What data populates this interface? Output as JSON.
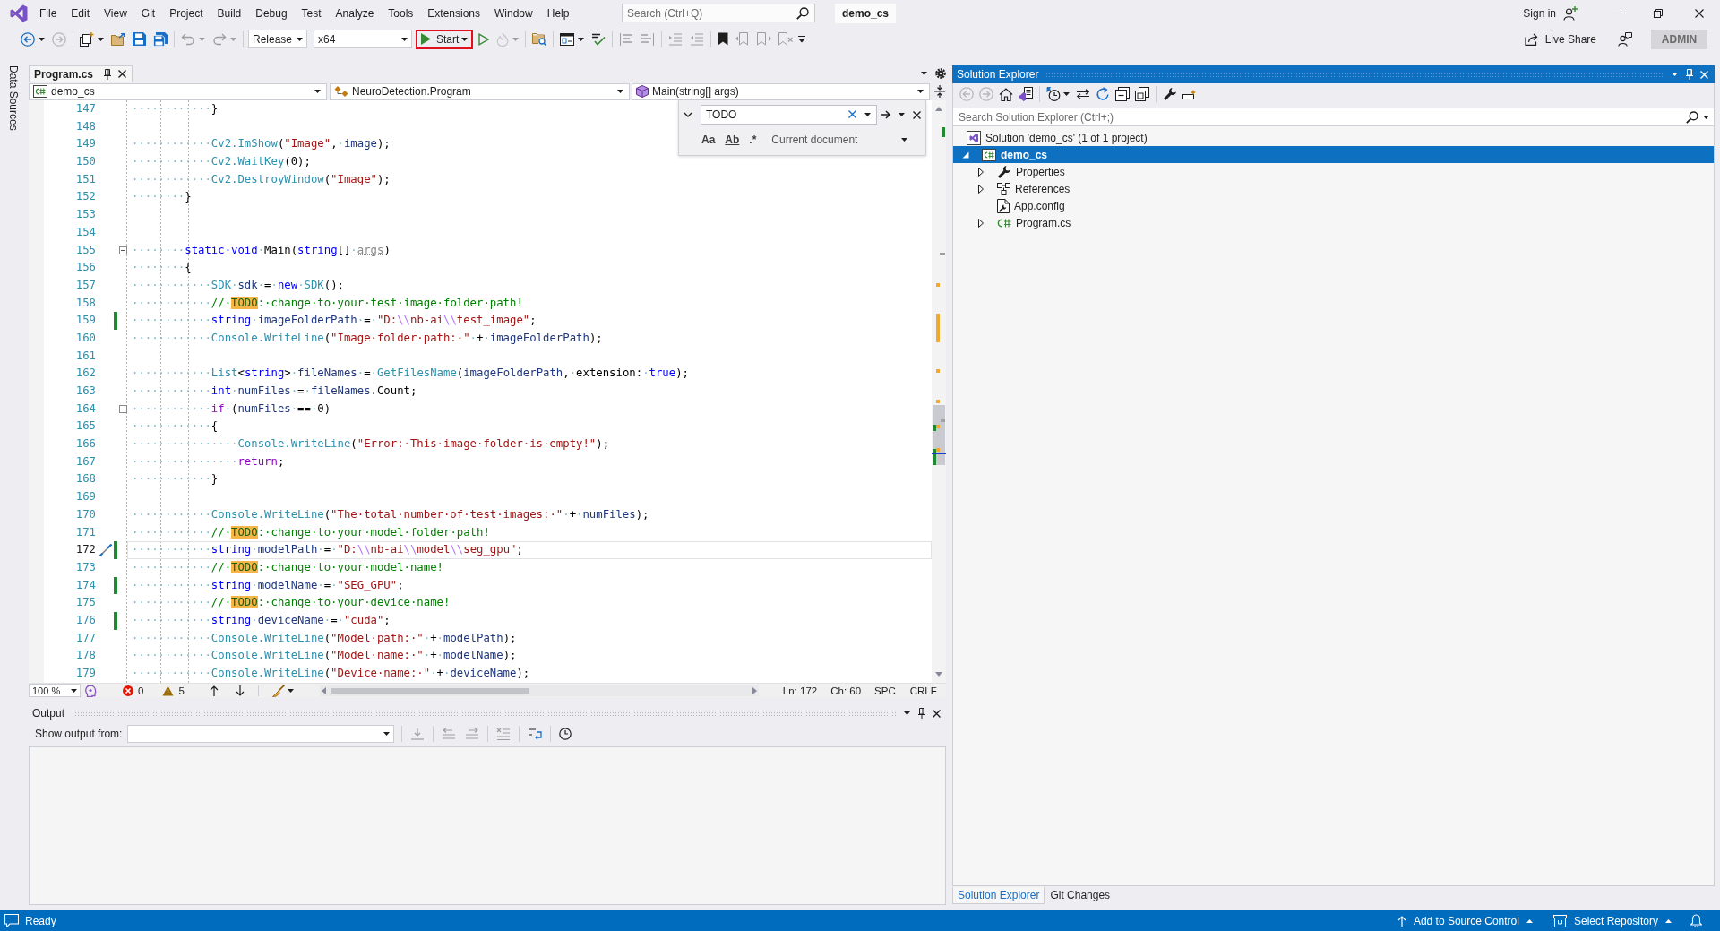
{
  "title_bar": {
    "menu": [
      "File",
      "Edit",
      "View",
      "Git",
      "Project",
      "Build",
      "Debug",
      "Test",
      "Analyze",
      "Tools",
      "Extensions",
      "Window",
      "Help"
    ],
    "search": {
      "placeholder": "Search (Ctrl+Q)"
    },
    "solution_name": "demo_cs",
    "sign_in": "Sign in"
  },
  "toolbar": {
    "left_groups": [
      [
        {
          "kind": "back",
          "disabled": false,
          "menu": true
        },
        {
          "kind": "forward",
          "disabled": true,
          "menu": false
        }
      ],
      [
        {
          "kind": "newitem",
          "disabled": false,
          "menu": true
        },
        {
          "kind": "open",
          "disabled": false,
          "menu": false
        },
        {
          "kind": "save",
          "disabled": false,
          "menu": false
        },
        {
          "kind": "saveall",
          "disabled": false,
          "menu": false
        }
      ],
      [
        {
          "kind": "undo",
          "disabled": true,
          "menu": true
        },
        {
          "kind": "redo",
          "disabled": true,
          "menu": true
        }
      ]
    ],
    "configuration": "Release",
    "platform": "x64",
    "start_button": {
      "label": "Start",
      "highlighted": true
    },
    "right_groups": [
      [
        {
          "kind": "run",
          "disabled": false,
          "menu": false
        },
        {
          "kind": "hotreload",
          "disabled": true,
          "menu": true
        }
      ],
      [
        {
          "kind": "findfiles",
          "disabled": false,
          "menu": false
        }
      ],
      [
        {
          "kind": "layout",
          "disabled": false,
          "menu": true
        },
        {
          "kind": "spellcheck",
          "disabled": false,
          "menu": false
        }
      ],
      [
        {
          "kind": "comment",
          "disabled": true,
          "menu": false
        },
        {
          "kind": "uncomment",
          "disabled": true,
          "menu": false
        }
      ],
      [
        {
          "kind": "indent",
          "disabled": true,
          "menu": false
        },
        {
          "kind": "outdent",
          "disabled": true,
          "menu": false
        }
      ],
      [
        {
          "kind": "bookmark",
          "disabled": false,
          "menu": false
        },
        {
          "kind": "prevbookmark",
          "disabled": true,
          "menu": false
        },
        {
          "kind": "nextbookmark",
          "disabled": true,
          "menu": false
        },
        {
          "kind": "clearbookmark",
          "disabled": true,
          "menu": false
        }
      ]
    ],
    "live_share": "Live Share",
    "account": "ADMIN"
  },
  "side_tab": "Data Sources",
  "editor": {
    "tabs": [
      {
        "label": "Program.cs",
        "selected": true
      }
    ],
    "navigation": {
      "project": "demo_cs",
      "type": "NeuroDetection.Program",
      "member": "Main(string[] args)"
    },
    "lines": [
      {
        "number": "147",
        "changed": false,
        "fold": false,
        "current": false,
        "tokens": [
          {
            "kind": "plain",
            "text": "············}"
          }
        ]
      },
      {
        "number": "148",
        "changed": false,
        "fold": false,
        "current": false
      },
      {
        "number": "149",
        "changed": false,
        "fold": false,
        "current": false,
        "tokens": [
          {
            "kind": "plain",
            "text": "············"
          },
          {
            "kind": "type",
            "text": "Cv2.ImShow"
          },
          {
            "kind": "plain",
            "text": "("
          },
          {
            "kind": "string",
            "text": "\"Image\""
          },
          {
            "kind": "plain",
            "text": ",·"
          },
          {
            "kind": "ident",
            "text": "image"
          },
          {
            "kind": "plain",
            "text": ");"
          }
        ]
      },
      {
        "number": "150",
        "changed": false,
        "fold": false,
        "current": false,
        "tokens": [
          {
            "kind": "plain",
            "text": "············"
          },
          {
            "kind": "type",
            "text": "Cv2.WaitKey"
          },
          {
            "kind": "plain",
            "text": "(0);"
          }
        ]
      },
      {
        "number": "151",
        "changed": false,
        "fold": false,
        "current": false,
        "tokens": [
          {
            "kind": "plain",
            "text": "············"
          },
          {
            "kind": "type",
            "text": "Cv2.DestroyWindow"
          },
          {
            "kind": "plain",
            "text": "("
          },
          {
            "kind": "string",
            "text": "\"Image\""
          },
          {
            "kind": "plain",
            "text": ");"
          }
        ]
      },
      {
        "number": "152",
        "changed": false,
        "fold": false,
        "current": false,
        "tokens": [
          {
            "kind": "plain",
            "text": "········}"
          }
        ]
      },
      {
        "number": "153",
        "changed": false,
        "fold": false,
        "current": false
      },
      {
        "number": "154",
        "changed": false,
        "fold": false,
        "current": false
      },
      {
        "number": "155",
        "changed": false,
        "fold": true,
        "current": false,
        "tokens": [
          {
            "kind": "plain",
            "text": "········"
          },
          {
            "kind": "keyword",
            "text": "static·void"
          },
          {
            "kind": "plain",
            "text": "·Main("
          },
          {
            "kind": "keyword",
            "text": "string"
          },
          {
            "kind": "plain",
            "text": "[]·"
          },
          {
            "kind": "unused",
            "text": "args"
          },
          {
            "kind": "plain",
            "text": ")"
          }
        ]
      },
      {
        "number": "156",
        "changed": false,
        "fold": false,
        "current": false,
        "tokens": [
          {
            "kind": "plain",
            "text": "········{"
          }
        ]
      },
      {
        "number": "157",
        "changed": false,
        "fold": false,
        "current": false,
        "tokens": [
          {
            "kind": "plain",
            "text": "············"
          },
          {
            "kind": "type",
            "text": "SDK"
          },
          {
            "kind": "plain",
            "text": "·"
          },
          {
            "kind": "ident",
            "text": "sdk"
          },
          {
            "kind": "plain",
            "text": "·=·"
          },
          {
            "kind": "keyword",
            "text": "new"
          },
          {
            "kind": "plain",
            "text": "·"
          },
          {
            "kind": "type",
            "text": "SDK"
          },
          {
            "kind": "plain",
            "text": "();"
          }
        ]
      },
      {
        "number": "158",
        "changed": false,
        "fold": false,
        "current": false,
        "tokens": [
          {
            "kind": "plain",
            "text": "············"
          },
          {
            "kind": "comment",
            "text": "//·"
          },
          {
            "kind": "match",
            "text": "TODO"
          },
          {
            "kind": "comment",
            "text": ":·change·to·your·test·image·folder·path!"
          }
        ]
      },
      {
        "number": "159",
        "changed": true,
        "fold": false,
        "current": false,
        "tokens": [
          {
            "kind": "plain",
            "text": "············"
          },
          {
            "kind": "keyword",
            "text": "string"
          },
          {
            "kind": "plain",
            "text": "·"
          },
          {
            "kind": "ident",
            "text": "imageFolderPath"
          },
          {
            "kind": "plain",
            "text": "·=·"
          },
          {
            "kind": "string",
            "text": "\"D:"
          },
          {
            "kind": "escape",
            "text": "\\\\"
          },
          {
            "kind": "string",
            "text": "nb-ai"
          },
          {
            "kind": "escape",
            "text": "\\\\"
          },
          {
            "kind": "string",
            "text": "test_image\""
          },
          {
            "kind": "plain",
            "text": ";"
          }
        ]
      },
      {
        "number": "160",
        "changed": false,
        "fold": false,
        "current": false,
        "tokens": [
          {
            "kind": "plain",
            "text": "············"
          },
          {
            "kind": "type",
            "text": "Console.WriteLine"
          },
          {
            "kind": "plain",
            "text": "("
          },
          {
            "kind": "string",
            "text": "\"Image·folder·path:·\""
          },
          {
            "kind": "plain",
            "text": "·+·"
          },
          {
            "kind": "ident",
            "text": "imageFolderPath"
          },
          {
            "kind": "plain",
            "text": ");"
          }
        ]
      },
      {
        "number": "161",
        "changed": false,
        "fold": false,
        "current": false
      },
      {
        "number": "162",
        "changed": false,
        "fold": false,
        "current": false,
        "tokens": [
          {
            "kind": "plain",
            "text": "············"
          },
          {
            "kind": "type",
            "text": "List"
          },
          {
            "kind": "plain",
            "text": "<"
          },
          {
            "kind": "keyword",
            "text": "string"
          },
          {
            "kind": "plain",
            "text": ">·"
          },
          {
            "kind": "ident",
            "text": "fileNames"
          },
          {
            "kind": "plain",
            "text": "·=·"
          },
          {
            "kind": "type",
            "text": "GetFilesName"
          },
          {
            "kind": "plain",
            "text": "("
          },
          {
            "kind": "ident",
            "text": "imageFolderPath"
          },
          {
            "kind": "plain",
            "text": ",·extension:·"
          },
          {
            "kind": "keyword",
            "text": "true"
          },
          {
            "kind": "plain",
            "text": ");"
          }
        ]
      },
      {
        "number": "163",
        "changed": false,
        "fold": false,
        "current": false,
        "tokens": [
          {
            "kind": "plain",
            "text": "············"
          },
          {
            "kind": "keyword",
            "text": "int"
          },
          {
            "kind": "plain",
            "text": "·"
          },
          {
            "kind": "ident",
            "text": "numFiles"
          },
          {
            "kind": "plain",
            "text": "·=·"
          },
          {
            "kind": "ident",
            "text": "fileNames"
          },
          {
            "kind": "plain",
            "text": ".Count;"
          }
        ]
      },
      {
        "number": "164",
        "changed": false,
        "fold": true,
        "current": false,
        "tokens": [
          {
            "kind": "plain",
            "text": "············"
          },
          {
            "kind": "control",
            "text": "if"
          },
          {
            "kind": "plain",
            "text": "·("
          },
          {
            "kind": "ident",
            "text": "numFiles"
          },
          {
            "kind": "plain",
            "text": "·==·0)"
          }
        ]
      },
      {
        "number": "165",
        "changed": false,
        "fold": false,
        "current": false,
        "tokens": [
          {
            "kind": "plain",
            "text": "············{"
          }
        ]
      },
      {
        "number": "166",
        "changed": false,
        "fold": false,
        "current": false,
        "tokens": [
          {
            "kind": "plain",
            "text": "················"
          },
          {
            "kind": "type",
            "text": "Console.WriteLine"
          },
          {
            "kind": "plain",
            "text": "("
          },
          {
            "kind": "string",
            "text": "\"Error:·This·image·folder·is·empty!\""
          },
          {
            "kind": "plain",
            "text": ");"
          }
        ]
      },
      {
        "number": "167",
        "changed": false,
        "fold": false,
        "current": false,
        "tokens": [
          {
            "kind": "plain",
            "text": "················"
          },
          {
            "kind": "control",
            "text": "return"
          },
          {
            "kind": "plain",
            "text": ";"
          }
        ]
      },
      {
        "number": "168",
        "changed": false,
        "fold": false,
        "current": false,
        "tokens": [
          {
            "kind": "plain",
            "text": "············}"
          }
        ]
      },
      {
        "number": "169",
        "changed": false,
        "fold": false,
        "current": false
      },
      {
        "number": "170",
        "changed": false,
        "fold": false,
        "current": false,
        "tokens": [
          {
            "kind": "plain",
            "text": "············"
          },
          {
            "kind": "type",
            "text": "Console.WriteLine"
          },
          {
            "kind": "plain",
            "text": "("
          },
          {
            "kind": "string",
            "text": "\"The·total·number·of·test·images:·\""
          },
          {
            "kind": "plain",
            "text": "·+·"
          },
          {
            "kind": "ident",
            "text": "numFiles"
          },
          {
            "kind": "plain",
            "text": ");"
          }
        ]
      },
      {
        "number": "171",
        "changed": false,
        "fold": false,
        "current": false,
        "tokens": [
          {
            "kind": "plain",
            "text": "············"
          },
          {
            "kind": "comment",
            "text": "//·"
          },
          {
            "kind": "match",
            "text": "TODO"
          },
          {
            "kind": "comment",
            "text": ":·change·to·your·model·folder·path!"
          }
        ]
      },
      {
        "number": "172",
        "changed": true,
        "fold": false,
        "current": true,
        "tokens": [
          {
            "kind": "plain",
            "text": "············"
          },
          {
            "kind": "keyword",
            "text": "string"
          },
          {
            "kind": "plain",
            "text": "·"
          },
          {
            "kind": "ident",
            "text": "modelPath"
          },
          {
            "kind": "plain",
            "text": "·=·"
          },
          {
            "kind": "string",
            "text": "\"D:"
          },
          {
            "kind": "escape",
            "text": "\\\\"
          },
          {
            "kind": "string",
            "text": "nb-ai"
          },
          {
            "kind": "escape",
            "text": "\\\\"
          },
          {
            "kind": "string",
            "text": "model"
          },
          {
            "kind": "escape",
            "text": "\\\\"
          },
          {
            "kind": "string",
            "text": "seg_gpu\""
          },
          {
            "kind": "plain",
            "text": ";"
          }
        ]
      },
      {
        "number": "173",
        "changed": false,
        "fold": false,
        "current": false,
        "tokens": [
          {
            "kind": "plain",
            "text": "············"
          },
          {
            "kind": "comment",
            "text": "//·"
          },
          {
            "kind": "match",
            "text": "TODO"
          },
          {
            "kind": "comment",
            "text": ":·change·to·your·model·name!"
          }
        ]
      },
      {
        "number": "174",
        "changed": true,
        "fold": false,
        "current": false,
        "tokens": [
          {
            "kind": "plain",
            "text": "············"
          },
          {
            "kind": "keyword",
            "text": "string"
          },
          {
            "kind": "plain",
            "text": "·"
          },
          {
            "kind": "ident",
            "text": "modelName"
          },
          {
            "kind": "plain",
            "text": "·=·"
          },
          {
            "kind": "string",
            "text": "\"SEG_GPU\""
          },
          {
            "kind": "plain",
            "text": ";"
          }
        ]
      },
      {
        "number": "175",
        "changed": false,
        "fold": false,
        "current": false,
        "tokens": [
          {
            "kind": "plain",
            "text": "············"
          },
          {
            "kind": "comment",
            "text": "//·"
          },
          {
            "kind": "match",
            "text": "TODO"
          },
          {
            "kind": "comment",
            "text": ":·change·to·your·device·name!"
          }
        ]
      },
      {
        "number": "176",
        "changed": true,
        "fold": false,
        "current": false,
        "tokens": [
          {
            "kind": "plain",
            "text": "············"
          },
          {
            "kind": "keyword",
            "text": "string"
          },
          {
            "kind": "plain",
            "text": "·"
          },
          {
            "kind": "ident",
            "text": "deviceName"
          },
          {
            "kind": "plain",
            "text": "·=·"
          },
          {
            "kind": "string",
            "text": "\"cuda\""
          },
          {
            "kind": "plain",
            "text": ";"
          }
        ]
      },
      {
        "number": "177",
        "changed": false,
        "fold": false,
        "current": false,
        "tokens": [
          {
            "kind": "plain",
            "text": "············"
          },
          {
            "kind": "type",
            "text": "Console.WriteLine"
          },
          {
            "kind": "plain",
            "text": "("
          },
          {
            "kind": "string",
            "text": "\"Model·path:·\""
          },
          {
            "kind": "plain",
            "text": "·+·"
          },
          {
            "kind": "ident",
            "text": "modelPath"
          },
          {
            "kind": "plain",
            "text": ");"
          }
        ]
      },
      {
        "number": "178",
        "changed": false,
        "fold": false,
        "current": false,
        "tokens": [
          {
            "kind": "plain",
            "text": "············"
          },
          {
            "kind": "type",
            "text": "Console.WriteLine"
          },
          {
            "kind": "plain",
            "text": "("
          },
          {
            "kind": "string",
            "text": "\"Model·name:·\""
          },
          {
            "kind": "plain",
            "text": "·+·"
          },
          {
            "kind": "ident",
            "text": "modelName"
          },
          {
            "kind": "plain",
            "text": ");"
          }
        ]
      },
      {
        "number": "179",
        "changed": false,
        "fold": false,
        "current": false,
        "tokens": [
          {
            "kind": "plain",
            "text": "············"
          },
          {
            "kind": "type",
            "text": "Console.WriteLine"
          },
          {
            "kind": "plain",
            "text": "("
          },
          {
            "kind": "string",
            "text": "\"Device·name:·\""
          },
          {
            "kind": "plain",
            "text": "·+·"
          },
          {
            "kind": "ident",
            "text": "deviceName"
          },
          {
            "kind": "plain",
            "text": ");"
          }
        ]
      }
    ],
    "find": {
      "value": "TODO",
      "options": [
        {
          "label": "Aa",
          "kind": "case",
          "selected": false
        },
        {
          "label": "Ab",
          "kind": "word",
          "selected": false
        },
        {
          "label": ".*",
          "kind": "regex",
          "selected": false
        }
      ],
      "scope": "Current document"
    },
    "status": {
      "zoom": "100 %",
      "errors": "0",
      "warnings": "5",
      "line": "Ln: 172",
      "column": "Ch: 60",
      "indent": "SPC",
      "line_endings": "CRLF"
    }
  },
  "output": {
    "title": "Output",
    "source_label": "Show output from:",
    "tools": [
      [
        {
          "kind": "gotoline",
          "disabled": true
        }
      ],
      [
        {
          "kind": "prevmsg",
          "disabled": true
        },
        {
          "kind": "nextmsg",
          "disabled": true
        }
      ],
      [
        {
          "kind": "clearall",
          "disabled": true
        }
      ],
      [
        {
          "kind": "wrap",
          "disabled": false
        }
      ],
      [
        {
          "kind": "timestamp",
          "disabled": false
        }
      ]
    ]
  },
  "solution_explorer": {
    "title": "Solution Explorer",
    "tools": [
      [
        {
          "kind": "back",
          "disabled": true,
          "menu": false
        },
        {
          "kind": "forward",
          "disabled": true,
          "menu": false
        },
        {
          "kind": "home",
          "disabled": false,
          "menu": false
        },
        {
          "kind": "views",
          "disabled": false,
          "menu": false
        }
      ],
      [
        {
          "kind": "pending",
          "disabled": false,
          "menu": true
        },
        {
          "kind": "sync",
          "disabled": false,
          "menu": false
        },
        {
          "kind": "refresh",
          "disabled": false,
          "menu": false
        },
        {
          "kind": "collapseall",
          "disabled": false,
          "menu": false
        },
        {
          "kind": "showall",
          "disabled": false,
          "menu": false
        }
      ],
      [
        {
          "kind": "properties",
          "disabled": false,
          "menu": false
        },
        {
          "kind": "preview",
          "disabled": false,
          "menu": false
        }
      ]
    ],
    "search": {
      "placeholder": "Search Solution Explorer (Ctrl+;)"
    },
    "tree": [
      {
        "label": "Solution 'demo_cs' (1 of 1 project)",
        "kind": "solution",
        "expandable": false,
        "expanded": true,
        "selected": false,
        "children": [
          {
            "label": "demo_cs",
            "kind": "project",
            "expandable": true,
            "expanded": true,
            "selected": true,
            "children": [
              {
                "label": "Properties",
                "kind": "properties",
                "expandable": true,
                "expanded": false,
                "selected": false
              },
              {
                "label": "References",
                "kind": "references",
                "expandable": true,
                "expanded": false,
                "selected": false
              },
              {
                "label": "App.config",
                "kind": "config",
                "expandable": false,
                "selected": false
              },
              {
                "label": "Program.cs",
                "kind": "code",
                "expandable": true,
                "expanded": false,
                "selected": false
              }
            ]
          }
        ]
      }
    ],
    "tabs": [
      {
        "label": "Solution Explorer",
        "selected": true
      },
      {
        "label": "Git Changes",
        "selected": false
      }
    ]
  },
  "status_bar": {
    "message": "Ready",
    "source_control": "Add to Source Control",
    "repository": "Select Repository"
  }
}
